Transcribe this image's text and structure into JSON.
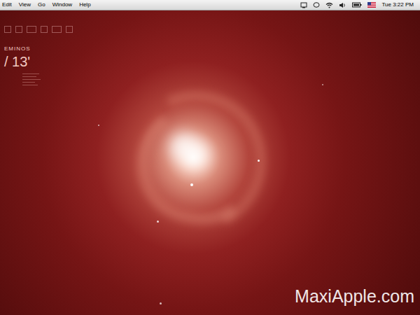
{
  "menu_bar": {
    "items": [
      "Edit",
      "View",
      "Go",
      "Window",
      "Help"
    ],
    "clock": "Tue 3:22 PM"
  },
  "desktop_widget": {
    "constellation": "EMINOS",
    "degree": "/ 13'"
  },
  "watermark": "MaxiApple.com"
}
